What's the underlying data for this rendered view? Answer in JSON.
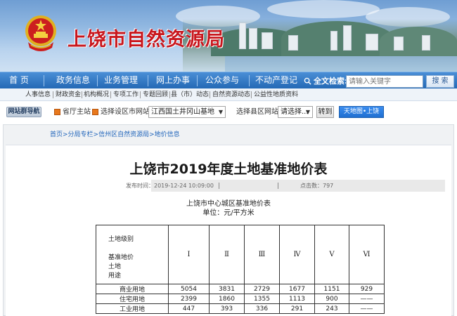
{
  "site": {
    "title": "上饶市自然资源局"
  },
  "nav": {
    "items": [
      {
        "label": "首 页"
      },
      {
        "label": "政务信息"
      },
      {
        "label": "业务管理"
      },
      {
        "label": "网上办事"
      },
      {
        "label": "公众参与"
      },
      {
        "label": "不动产登记"
      }
    ]
  },
  "search": {
    "label": "全文检索:",
    "placeholder": "请输入关键字",
    "button": "搜 索"
  },
  "subnav": {
    "items": [
      {
        "label": "人事信息"
      },
      {
        "label": "财政资金"
      },
      {
        "label": "机构概况"
      },
      {
        "label": "专项工作"
      },
      {
        "label": "专题回顾"
      },
      {
        "label": "县（市）动态"
      },
      {
        "label": "自然资源动态"
      },
      {
        "label": "公益性地质资料"
      }
    ]
  },
  "group": {
    "badge": "网站群导航",
    "province": "省厅主站",
    "city_label": "选择设区市网站:",
    "city_value": "江西国土井冈山基地",
    "county_label": "选择县区网站:",
    "county_value": "请选择...",
    "go": "转到",
    "tianditu": "天地图•上饶"
  },
  "breadcrumb": "首页>分局专栏>信州区自然资源局>地价信息",
  "article": {
    "title": "上饶市2019年度土地基准地价表",
    "publish_time": "发布时间：2019-12-24 10:09:00",
    "clicks": "点击数：797",
    "table_title": "上饶市中心城区基准地价表",
    "unit": "单位：元/平方米"
  },
  "table": {
    "header_lines": [
      "土地级别",
      "",
      "基准地价",
      "土地",
      "用途"
    ],
    "levels": [
      "Ⅰ",
      "Ⅱ",
      "Ⅲ",
      "Ⅳ",
      "Ⅴ",
      "Ⅵ"
    ],
    "rows": [
      {
        "use": "商业用地",
        "values": [
          "5054",
          "3831",
          "2729",
          "1677",
          "1151",
          "929"
        ]
      },
      {
        "use": "住宅用地",
        "values": [
          "2399",
          "1860",
          "1355",
          "1113",
          "900",
          "——"
        ]
      },
      {
        "use": "工业用地",
        "values": [
          "447",
          "393",
          "336",
          "291",
          "243",
          "——"
        ]
      }
    ]
  },
  "colors": {
    "site_title": "#c8161d",
    "nav_bg": "#2469b5",
    "link": "#2266bb",
    "checkbox": "#e8781c"
  }
}
